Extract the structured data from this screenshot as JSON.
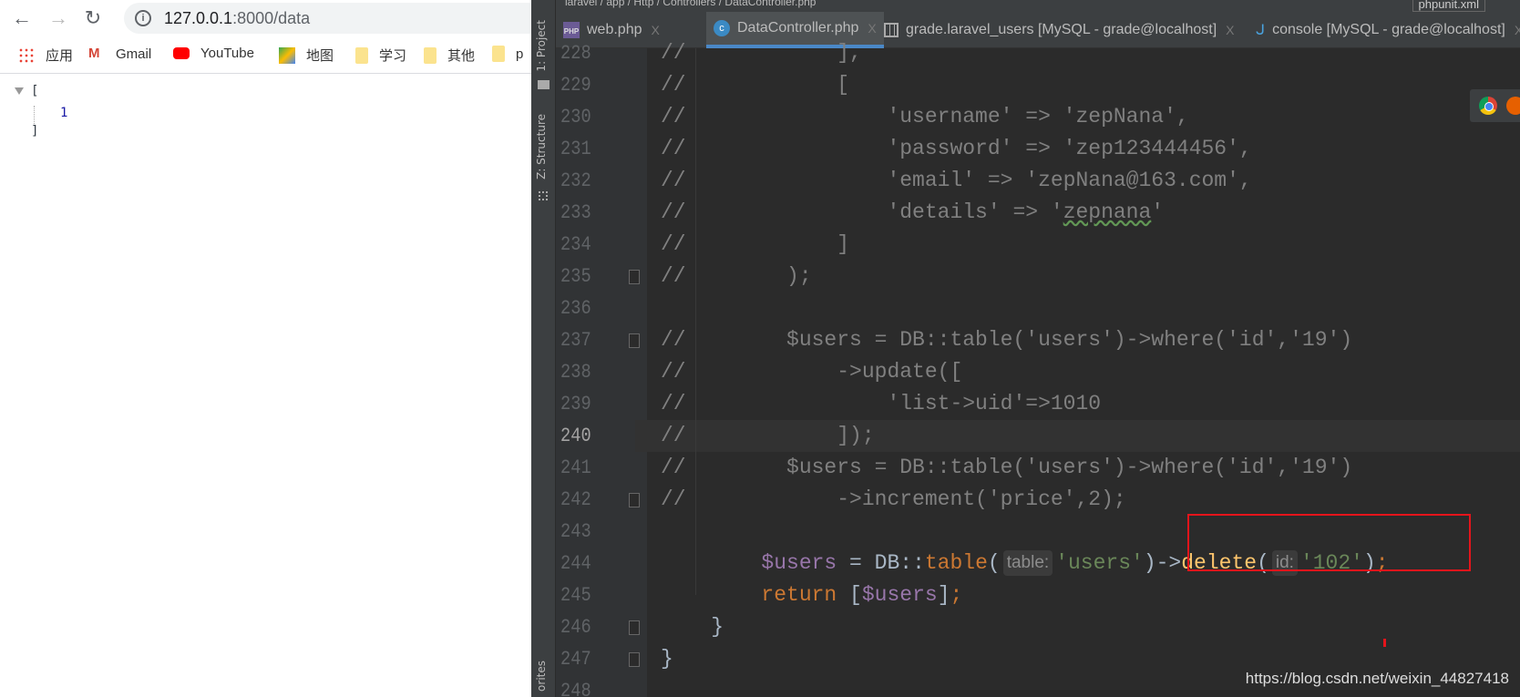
{
  "browser": {
    "url_host": "127.0.0.1",
    "url_path": ":8000/data",
    "bookmarks": [
      {
        "label": "应用",
        "icon": "apps-grid-icon"
      },
      {
        "label": "Gmail",
        "icon": "gmail-icon"
      },
      {
        "label": "YouTube",
        "icon": "youtube-icon"
      },
      {
        "label": "地图",
        "icon": "maps-icon"
      },
      {
        "label": "学习",
        "icon": "folder-icon"
      },
      {
        "label": "其他",
        "icon": "folder-icon"
      },
      {
        "label": "p",
        "icon": "folder-icon"
      }
    ],
    "json_open": "[",
    "json_value": "1",
    "json_close": "]"
  },
  "ide": {
    "sidebar": {
      "project": "1: Project",
      "structure": "Z: Structure",
      "favorites": "orites"
    },
    "breadcrumb": "laravel / app / Http / Controllers / DataController.php",
    "breadcrumb_right": "phpunit.xml",
    "tabs": [
      {
        "label": "web.php",
        "icon": "php-file-icon",
        "active": false
      },
      {
        "label": "DataController.php",
        "icon": "php-class-icon",
        "active": true
      },
      {
        "label": "grade.laravel_users [MySQL - grade@localhost]",
        "icon": "table-icon",
        "active": false
      },
      {
        "label": "console [MySQL - grade@localhost]",
        "icon": "mysql-console-icon",
        "active": false
      }
    ],
    "current_line": 240,
    "lines": [
      {
        "n": "228",
        "tokens": [
          {
            "t": "//            ],",
            "c": "cm"
          }
        ]
      },
      {
        "n": "229",
        "tokens": [
          {
            "t": "//            [",
            "c": "cm"
          }
        ]
      },
      {
        "n": "230",
        "tokens": [
          {
            "t": "//                'username' => 'zepNana',",
            "c": "cm"
          }
        ]
      },
      {
        "n": "231",
        "tokens": [
          {
            "t": "//                'password' => 'zep123444456',",
            "c": "cm"
          }
        ]
      },
      {
        "n": "232",
        "tokens": [
          {
            "t": "//                'email' => 'zepNana@163.com',",
            "c": "cm"
          }
        ]
      },
      {
        "n": "233",
        "tokens": [
          {
            "t": "//                'details' => '",
            "c": "cm"
          },
          {
            "t": "zepnana",
            "c": "cm wavy"
          },
          {
            "t": "'",
            "c": "cm"
          }
        ]
      },
      {
        "n": "234",
        "tokens": [
          {
            "t": "//            ]",
            "c": "cm"
          }
        ]
      },
      {
        "n": "235",
        "tokens": [
          {
            "t": "//        );",
            "c": "cm"
          }
        ]
      },
      {
        "n": "236",
        "tokens": []
      },
      {
        "n": "237",
        "tokens": [
          {
            "t": "//        $users = DB::table('users')->where('id','19')",
            "c": "cm"
          }
        ]
      },
      {
        "n": "238",
        "tokens": [
          {
            "t": "//            ->update([",
            "c": "cm"
          }
        ]
      },
      {
        "n": "239",
        "tokens": [
          {
            "t": "//                'list->uid'=>1010",
            "c": "cm"
          }
        ]
      },
      {
        "n": "240",
        "tokens": [
          {
            "t": "//            ]);",
            "c": "cm"
          }
        ]
      },
      {
        "n": "241",
        "tokens": [
          {
            "t": "//        $users = DB::table('users')->where('id','19')",
            "c": "cm"
          }
        ]
      },
      {
        "n": "242",
        "tokens": [
          {
            "t": "//            ->increment('price',2);",
            "c": "cm"
          }
        ]
      },
      {
        "n": "243",
        "tokens": []
      },
      {
        "n": "244",
        "tokens": [
          {
            "t": "        ",
            "c": ""
          },
          {
            "t": "$users",
            "c": "var"
          },
          {
            "t": " = DB::",
            "c": "cls"
          },
          {
            "t": "table",
            "c": "tfn"
          },
          {
            "t": "(",
            "c": "cls"
          },
          {
            "t": "table:",
            "c": "hint"
          },
          {
            "t": "'users'",
            "c": "str"
          },
          {
            "t": ")->",
            "c": "cls"
          },
          {
            "t": "delete",
            "c": "mth"
          },
          {
            "t": "(",
            "c": "cls"
          },
          {
            "t": "id:",
            "c": "hint"
          },
          {
            "t": "'102'",
            "c": "str"
          },
          {
            "t": ")",
            "c": "cls"
          },
          {
            "t": ";",
            "c": "kw"
          }
        ]
      },
      {
        "n": "245",
        "tokens": [
          {
            "t": "        ",
            "c": ""
          },
          {
            "t": "return",
            "c": "kw"
          },
          {
            "t": " [",
            "c": "cls"
          },
          {
            "t": "$users",
            "c": "var"
          },
          {
            "t": "]",
            "c": "cls"
          },
          {
            "t": ";",
            "c": "kw"
          }
        ]
      },
      {
        "n": "246",
        "tokens": [
          {
            "t": "    }",
            "c": "cls"
          }
        ]
      },
      {
        "n": "247",
        "tokens": [
          {
            "t": "}",
            "c": "cls"
          }
        ]
      },
      {
        "n": "248",
        "tokens": []
      }
    ],
    "fold_lines": [
      "235",
      "237",
      "242",
      "246",
      "247"
    ]
  },
  "colors": {
    "highlight_box": "#e5141b",
    "editor_bg": "#2b2b2b",
    "active_tab_underline": "#4a88c7"
  },
  "watermark": "https://blog.csdn.net/weixin_44827418"
}
